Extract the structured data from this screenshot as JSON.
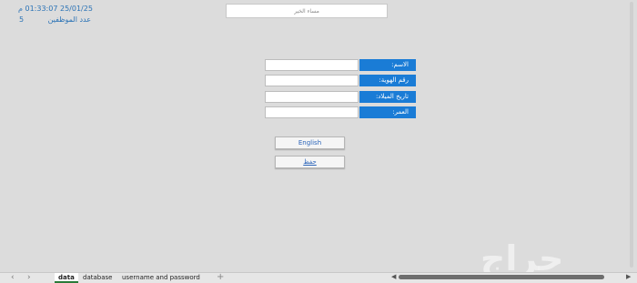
{
  "header": {
    "datetime": "25/01/25 01:33:07 م",
    "employee_count_label": "عدد الموظفين",
    "employee_count_value": "5"
  },
  "greeting": "مساء الخير",
  "form": {
    "fields": [
      {
        "label": "الاسم:",
        "value": ""
      },
      {
        "label": "رقم الهوية:",
        "value": ""
      },
      {
        "label": "تاريخ الميلاد:",
        "value": ""
      },
      {
        "label": "العمر:",
        "value": ""
      }
    ],
    "language_button": "English",
    "save_button": "حفظ"
  },
  "sheet_tabs": {
    "tabs": [
      "data",
      "database",
      "username and password"
    ],
    "active": "data",
    "add_label": "+"
  },
  "watermark": "حراج",
  "colors": {
    "label_bg": "#1a7cd6",
    "accent_text": "#2b73b6",
    "active_tab_underline": "#2a7a3a"
  }
}
